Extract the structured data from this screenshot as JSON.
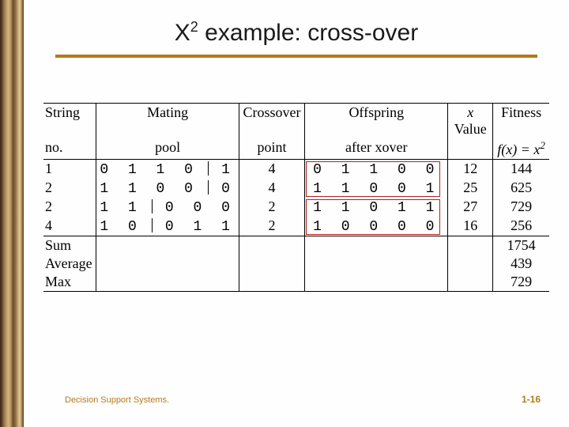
{
  "title": {
    "base": "X",
    "sup": "2",
    "rest": " example: cross-over"
  },
  "headers": {
    "c1a": "String",
    "c1b": "no.",
    "c2": "Mating",
    "c2b": "pool",
    "c3": "Crossover",
    "c3b": "point",
    "c4": "Offspring",
    "c4b": "after xover",
    "c5a": "x",
    "c5b": " Value",
    "c6": "Fitness",
    "c6b_lhs": "f(x) = x",
    "c6b_pow": "2"
  },
  "rows": [
    {
      "no": "1",
      "mating_pre": "0 1 1 0 ",
      "mating_post": " 1",
      "cross": "4",
      "off": "0 1 1 0 0",
      "xval": "12",
      "fit": "144"
    },
    {
      "no": "2",
      "mating_pre": "1 1 0 0 ",
      "mating_post": " 0",
      "cross": "4",
      "off": "1 1 0 0 1",
      "xval": "25",
      "fit": "625"
    },
    {
      "no": "2",
      "mating_pre": "1 1 ",
      "mating_post": " 0 0 0",
      "cross": "2",
      "off": "1 1 0 1 1",
      "xval": "27",
      "fit": "729"
    },
    {
      "no": "4",
      "mating_pre": "1 0 ",
      "mating_post": " 0 1 1",
      "cross": "2",
      "off": "1 0 0 0 0",
      "xval": "16",
      "fit": "256"
    }
  ],
  "summary": {
    "l1": "Sum",
    "v1": "1754",
    "l2": "Average",
    "v2": "439",
    "l3": "Max",
    "v3": "729"
  },
  "footer": {
    "left": "Decision Support Systems.",
    "right": "1-16"
  }
}
